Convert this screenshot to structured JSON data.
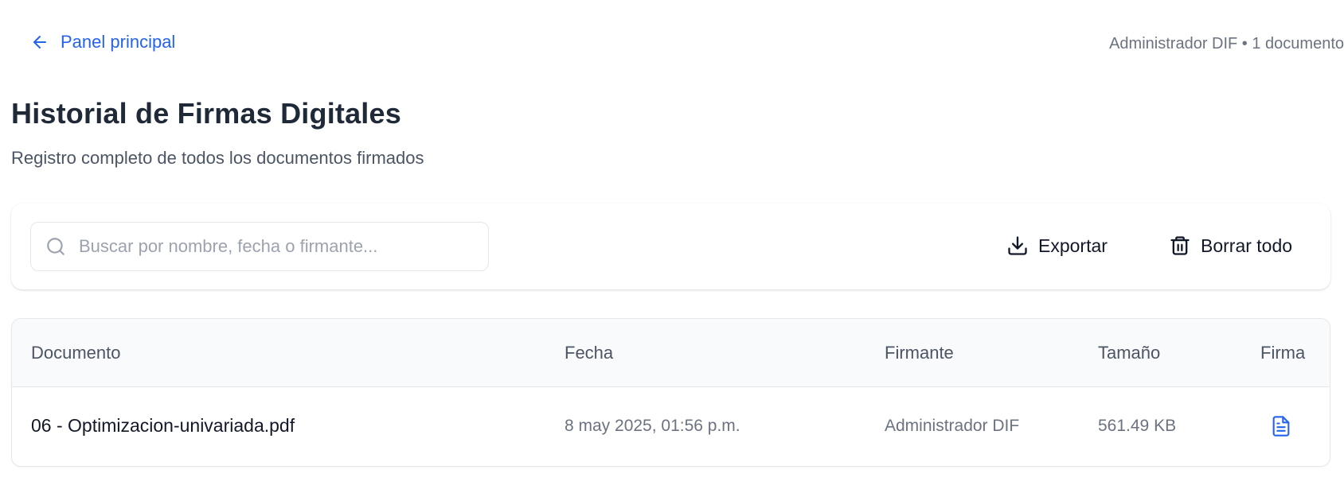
{
  "header": {
    "back_label": "Panel principal",
    "user_meta": "Administrador DIF • 1 documento"
  },
  "page": {
    "title": "Historial de Firmas Digitales",
    "subtitle": "Registro completo de todos los documentos firmados"
  },
  "toolbar": {
    "search_placeholder": "Buscar por nombre, fecha o firmante...",
    "search_value": "",
    "export_label": "Exportar",
    "clear_label": "Borrar todo"
  },
  "table": {
    "columns": [
      "Documento",
      "Fecha",
      "Firmante",
      "Tamaño",
      "Firma"
    ],
    "rows": [
      {
        "document": "06 - Optimizacion-univariada.pdf",
        "date": "8 may 2025, 01:56 p.m.",
        "signer": "Administrador DIF",
        "size": "561.49 KB",
        "signature_icon": "file-text-icon"
      }
    ]
  },
  "icons": {
    "back": "arrow-left-icon",
    "search": "search-icon",
    "export": "download-icon",
    "clear": "trash-icon"
  },
  "colors": {
    "accent": "#2563eb",
    "text_primary": "#1f2937",
    "text_muted": "#6b7280",
    "border": "#e5e7eb",
    "header_bg": "#f9fafb"
  }
}
